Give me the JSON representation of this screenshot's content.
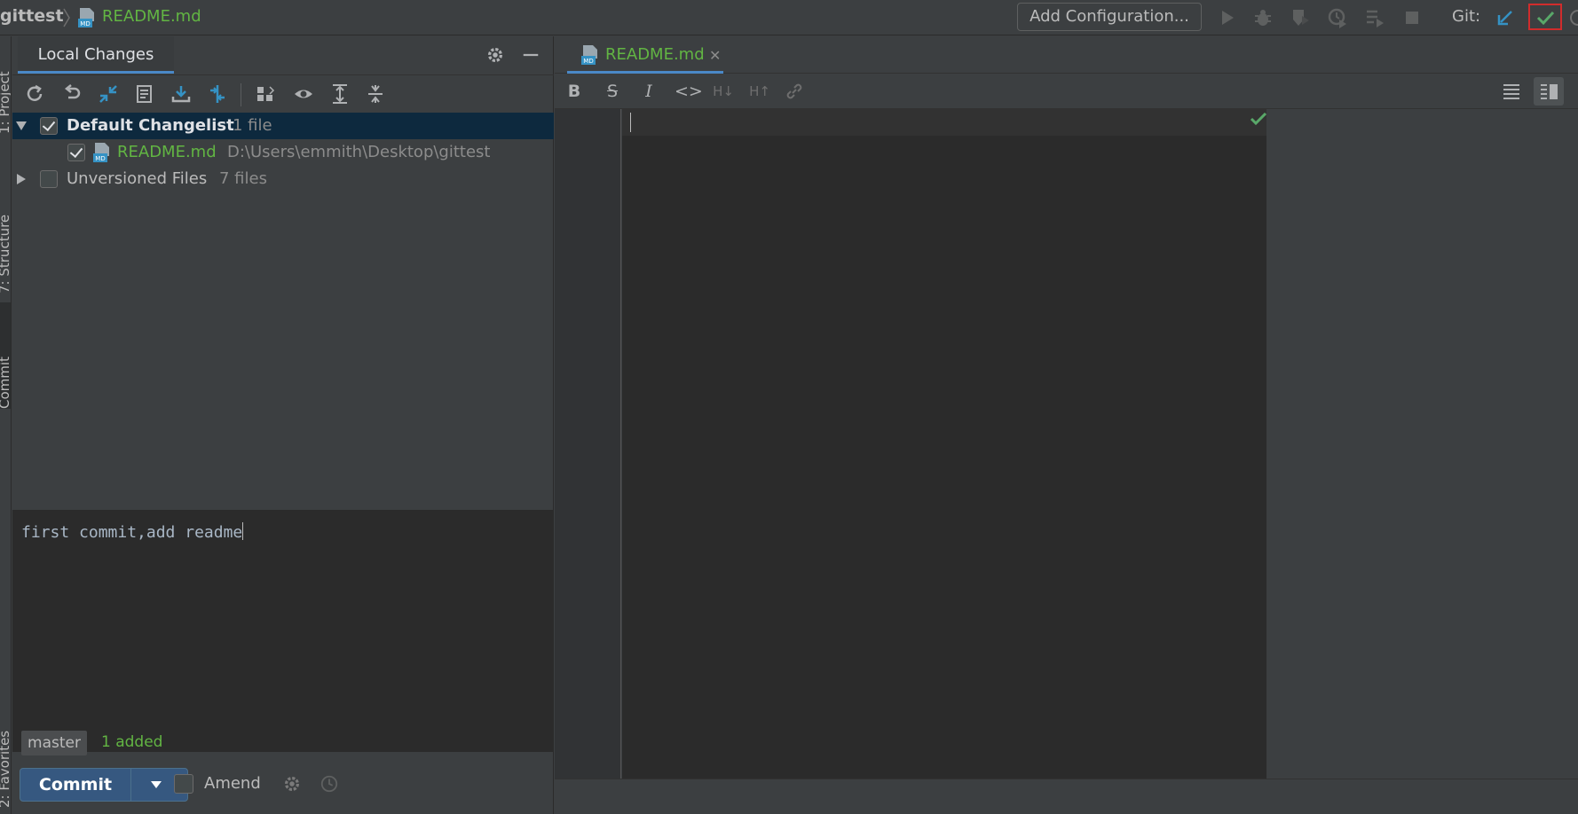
{
  "navbar": {
    "project": "gittest",
    "file": "README.md",
    "run_config": "Add Configuration...",
    "vcs_label": "Git:"
  },
  "left_strip": {
    "tabs": [
      "1: Project",
      "7: Structure",
      "Commit",
      "2: Favorites"
    ]
  },
  "commit_panel": {
    "tab": "Local Changes",
    "changelists": [
      {
        "name": "Default Changelist",
        "count": "1 file",
        "checked": true,
        "expanded": true
      },
      {
        "name": "Unversioned Files",
        "count": "7 files",
        "checked": false,
        "expanded": false
      }
    ],
    "changed_file": {
      "name": "README.md",
      "path": "D:\\Users\\emmith\\Desktop\\gittest",
      "checked": true
    },
    "commit_message": "first commit,add readme",
    "branch": "master",
    "status": "1 added",
    "commit_button": "Commit",
    "amend_label": "Amend"
  },
  "editor": {
    "tab_label": "README.md",
    "markdown_toolbar": [
      "B",
      "S",
      "I",
      "<>",
      "H↓",
      "H↑",
      "link"
    ]
  },
  "colors": {
    "background": "#3c3f41",
    "editor_bg": "#2b2b2b",
    "added_green": "#62b543",
    "accent_blue": "#4a88c7",
    "commit_button": "#365880",
    "highlight_red": "#d12c2c"
  }
}
